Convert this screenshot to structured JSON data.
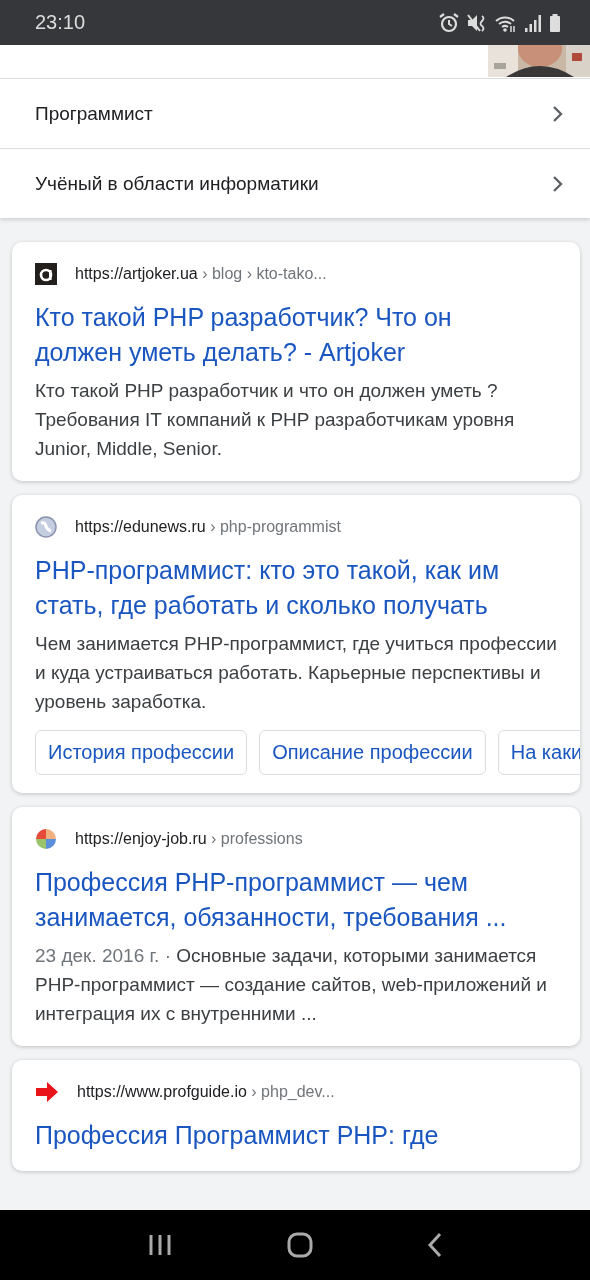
{
  "status_bar": {
    "time": "23:10"
  },
  "related": {
    "items": [
      {
        "label": "Программист"
      },
      {
        "label": "Учёный в области информатики"
      }
    ]
  },
  "results": [
    {
      "kind": "letter",
      "site": "https://artjoker.ua",
      "path": " › blog › kto-tako...",
      "title": "Кто такой PHP разработчик? Что он должен уметь делать? - Artjoker",
      "snippet": "Кто такой PHP разработчик и что он должен уметь ? Требования IT компаний к PHP разработчикам уровня Junior, Middle, Senior."
    },
    {
      "kind": "globe",
      "site": "https://edunews.ru",
      "path": " › php-programmist",
      "title": "PHP-программист: кто это такой, как им стать, где работать и сколько получать",
      "snippet": "Чем занимается PHP-программист, где учиться профессии и куда устраиваться работать. Карьерные перспективы и уровень заработка.",
      "chips": [
        "История профессии",
        "Описание профессии",
        "На каки"
      ]
    },
    {
      "kind": "pinwheel",
      "site": "https://enjoy-job.ru",
      "path": " › professions",
      "title": "Профессия PHP-программист — чем занимается, обязанности, требования ...",
      "date": "23 дек. 2016 г. · ",
      "snippet": "Основные задачи, которыми занимается PHP-программист — создание сайтов, web-приложений и интеграция их с внутренними ..."
    },
    {
      "kind": "arrow",
      "site": "https://www.profguide.io",
      "path": " › php_dev...",
      "title": "Профессия Программист PHP: где"
    }
  ]
}
